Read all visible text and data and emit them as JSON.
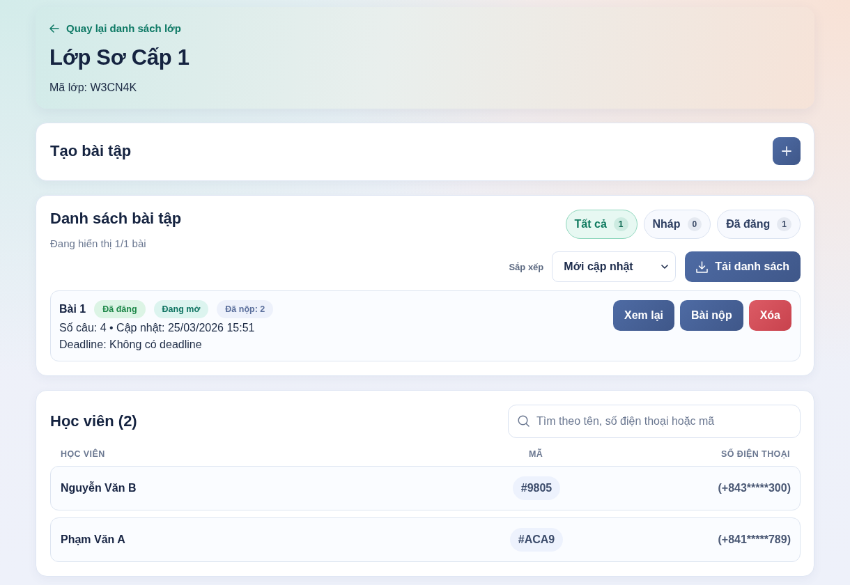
{
  "header": {
    "back_link": "Quay lại danh sách lớp",
    "title": "Lớp Sơ Cấp 1",
    "class_code": "Mã lớp: W3CN4K"
  },
  "create_panel": {
    "title": "Tạo bài tập"
  },
  "assignments": {
    "title": "Danh sách bài tập",
    "summary": "Đang hiển thị 1/1 bài",
    "filters": [
      {
        "label": "Tất cả",
        "count": "1",
        "selected": true
      },
      {
        "label": "Nháp",
        "count": "0",
        "selected": false
      },
      {
        "label": "Đã đăng",
        "count": "1",
        "selected": false
      }
    ],
    "sort": {
      "label": "Sắp xếp",
      "value": "Mới cập nhật"
    },
    "download_button": "Tải danh sách",
    "items": [
      {
        "title": "Bài 1",
        "tags": [
          {
            "label": "Đã đăng",
            "kind": "success"
          },
          {
            "label": "Đang mở",
            "kind": "open"
          },
          {
            "label": "Đã nộp: 2",
            "kind": "info"
          }
        ],
        "meta": "Số câu: 4 • Cập nhật: 25/03/2026 15:51",
        "deadline": "Deadline: Không có deadline",
        "actions": [
          {
            "label": "Xem lại",
            "kind": "primary"
          },
          {
            "label": "Bài nộp",
            "kind": "primary"
          },
          {
            "label": "Xóa",
            "kind": "danger"
          }
        ]
      }
    ]
  },
  "students": {
    "title": "Học viên (2)",
    "search": {
      "placeholder": "Tìm theo tên, số điện thoại hoặc mã"
    },
    "columns": [
      "HỌC VIÊN",
      "MÃ",
      "SỐ ĐIỆN THOẠI"
    ],
    "rows": [
      {
        "name": "Nguyễn Văn B",
        "code": "#9805",
        "phone": "(+843*****300)"
      },
      {
        "name": "Phạm Văn A",
        "code": "#ACA9",
        "phone": "(+841*****789)"
      }
    ]
  }
}
